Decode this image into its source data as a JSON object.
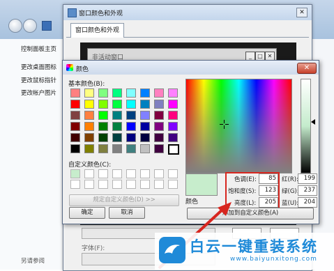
{
  "control_panel": {
    "sidebar": [
      "控制面板主页",
      "更改桌面图标",
      "更改鼠标指针",
      "更改帐户图片"
    ],
    "footer": "另请参阅"
  },
  "appearance_window": {
    "title": "窗口颜色和外观",
    "tab": "窗口颜色和外观",
    "inactive_window_title": "非活动窗口",
    "font_label": "字体(F):"
  },
  "color_dialog": {
    "title": "颜色",
    "basic_colors_label": "基本颜色(B):",
    "custom_colors_label": "自定义颜色(C):",
    "define_custom_button": "规定自定义颜色(D) >>",
    "ok_button": "确定",
    "cancel_button": "取消",
    "color_label": "颜色",
    "add_custom_button": "添加到自定义颜色(A)",
    "hue_label": "色调(E):",
    "hue": "85",
    "sat_label": "饱和度(S):",
    "sat": "123",
    "lum_label": "亮度(L):",
    "lum": "205",
    "red_label": "红(R):",
    "red": "199",
    "green_label": "绿(G):",
    "green": "237",
    "blue_label": "蓝(U):",
    "blue": "204",
    "current_color": "#c7edcc",
    "basic_colors": [
      "#ff8080",
      "#ffff80",
      "#80ff80",
      "#00ff80",
      "#80ffff",
      "#0080ff",
      "#ff80c0",
      "#ff80ff",
      "#ff0000",
      "#ffff00",
      "#80ff00",
      "#00ff40",
      "#00ffff",
      "#0080c0",
      "#8080c0",
      "#ff00ff",
      "#804040",
      "#ff8040",
      "#00ff00",
      "#008080",
      "#004080",
      "#8080ff",
      "#800040",
      "#ff0080",
      "#800000",
      "#ff8000",
      "#008000",
      "#008040",
      "#0000ff",
      "#0000a0",
      "#800080",
      "#8000ff",
      "#400000",
      "#804000",
      "#004000",
      "#004040",
      "#000080",
      "#000040",
      "#400040",
      "#400080",
      "#000000",
      "#808000",
      "#808040",
      "#808080",
      "#408080",
      "#c0c0c0",
      "#400040",
      "#ffffff"
    ]
  },
  "watermark": {
    "brand": "白云一键重装系统",
    "url": "www.baiyunxitong.com"
  }
}
